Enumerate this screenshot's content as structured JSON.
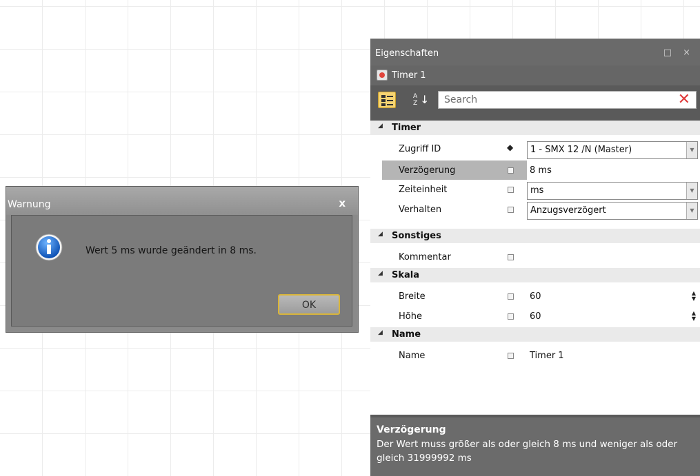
{
  "dialog": {
    "title": "Warnung",
    "close": "x",
    "message": "Wert 5 ms wurde geändert in 8 ms.",
    "ok": "OK",
    "icon": "info-icon"
  },
  "panel": {
    "title": "Eigenschaften",
    "controls": "□ ×",
    "object_name": "Timer 1",
    "search_placeholder": "Search",
    "search_clear": "✕",
    "sort_top": "A",
    "sort_bottom": "Z",
    "categories": [
      {
        "label": "Timer"
      },
      {
        "label": "Sonstiges"
      },
      {
        "label": "Skala"
      },
      {
        "label": "Name"
      }
    ],
    "properties": {
      "zugriff": {
        "name": "Zugriff ID",
        "value": "1 - SMX 12 /N (Master)"
      },
      "verzoeg": {
        "name": "Verzögerung",
        "value": "8 ms"
      },
      "zeit": {
        "name": "Zeiteinheit",
        "value": "ms"
      },
      "verhalten": {
        "name": "Verhalten",
        "value": "Anzugsverzögert"
      },
      "kommentar": {
        "name": "Kommentar",
        "value": ""
      },
      "breite": {
        "name": "Breite",
        "value": "60"
      },
      "hoehe": {
        "name": "Höhe",
        "value": "60"
      },
      "name": {
        "name": "Name",
        "value": "Timer 1"
      }
    },
    "description": {
      "title": "Verzögerung",
      "text": "Der Wert muss größer als oder gleich 8  ms und  weniger als oder gleich 31999992  ms"
    }
  }
}
